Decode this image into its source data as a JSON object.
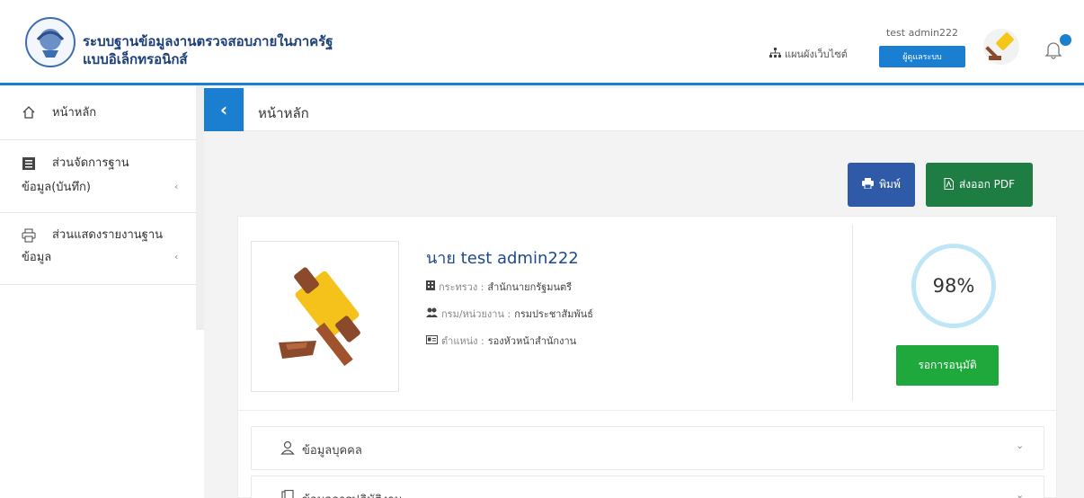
{
  "header": {
    "title_line1": "ระบบฐานข้อมูลงานตรวจสอบภายในภาครัฐ",
    "title_line2": "แบบอิเล็กทรอนิกส์",
    "sitemap_label": "แผนผังเว็บไซต์",
    "user_name": "test admin222",
    "role_label": "ผู้ดูแลระบบ",
    "logo_icon": "government-seal-icon",
    "avatar_icon": "gavel-icon",
    "bell_icon": "bell-icon",
    "accent_color": "#1a7fd0"
  },
  "sidebar": {
    "items": [
      {
        "icon": "home-icon",
        "label_line1": "หน้าหลัก",
        "label_line2": ""
      },
      {
        "icon": "list-icon",
        "label_line1": "ส่วนจัดการฐาน",
        "label_line2": "ข้อมูล(บันทึก)"
      },
      {
        "icon": "print-icon",
        "label_line1": "ส่วนแสดงรายงานฐาน",
        "label_line2": "ข้อมูล"
      }
    ]
  },
  "main": {
    "page_title": "หน้าหลัก",
    "print_label": "พิมพ์",
    "pdf_label": "ส่งออก PDF",
    "profile": {
      "name": "นาย test admin222",
      "ministry_key": "กระทรวง :",
      "ministry_value": "สำนักนายกรัฐมนตรี",
      "department_key": "กรม/หน่วยงาน :",
      "department_value": "กรมประชาสัมพันธ์",
      "position_key": "ตำแหน่ง :",
      "position_value": "รองหัวหน้าสำนักงาน"
    },
    "completion_percent": "98%",
    "status_label": "รอการอนุมัติ",
    "accordions": [
      {
        "icon": "user-icon",
        "label": "ข้อมูลบุคคล"
      },
      {
        "icon": "document-icon",
        "label": "ข้อมูลการปฏิบัติงาน"
      }
    ]
  }
}
